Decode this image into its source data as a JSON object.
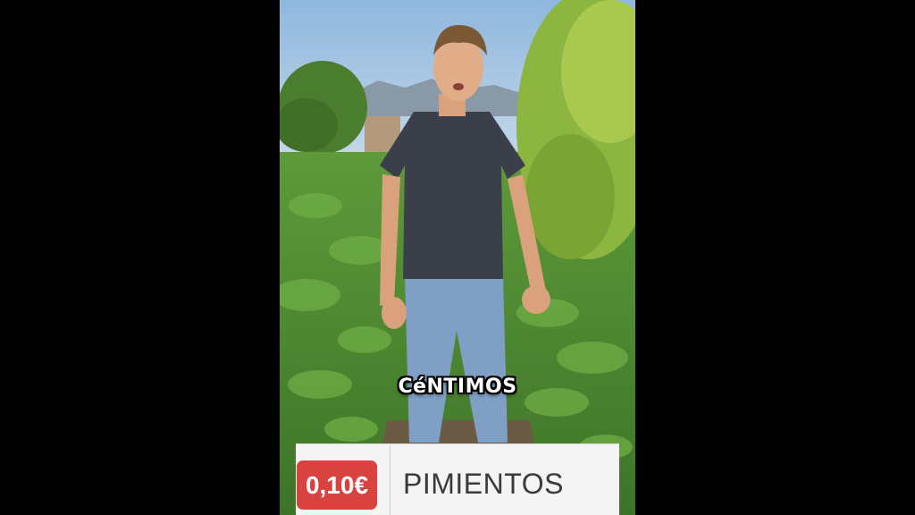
{
  "caption": {
    "text": "CéNTIMOS",
    "color": "#ffffff"
  },
  "price_card": {
    "price": "0,10€",
    "product": "PIMIENTOS",
    "badge_color": "#d8423f"
  }
}
